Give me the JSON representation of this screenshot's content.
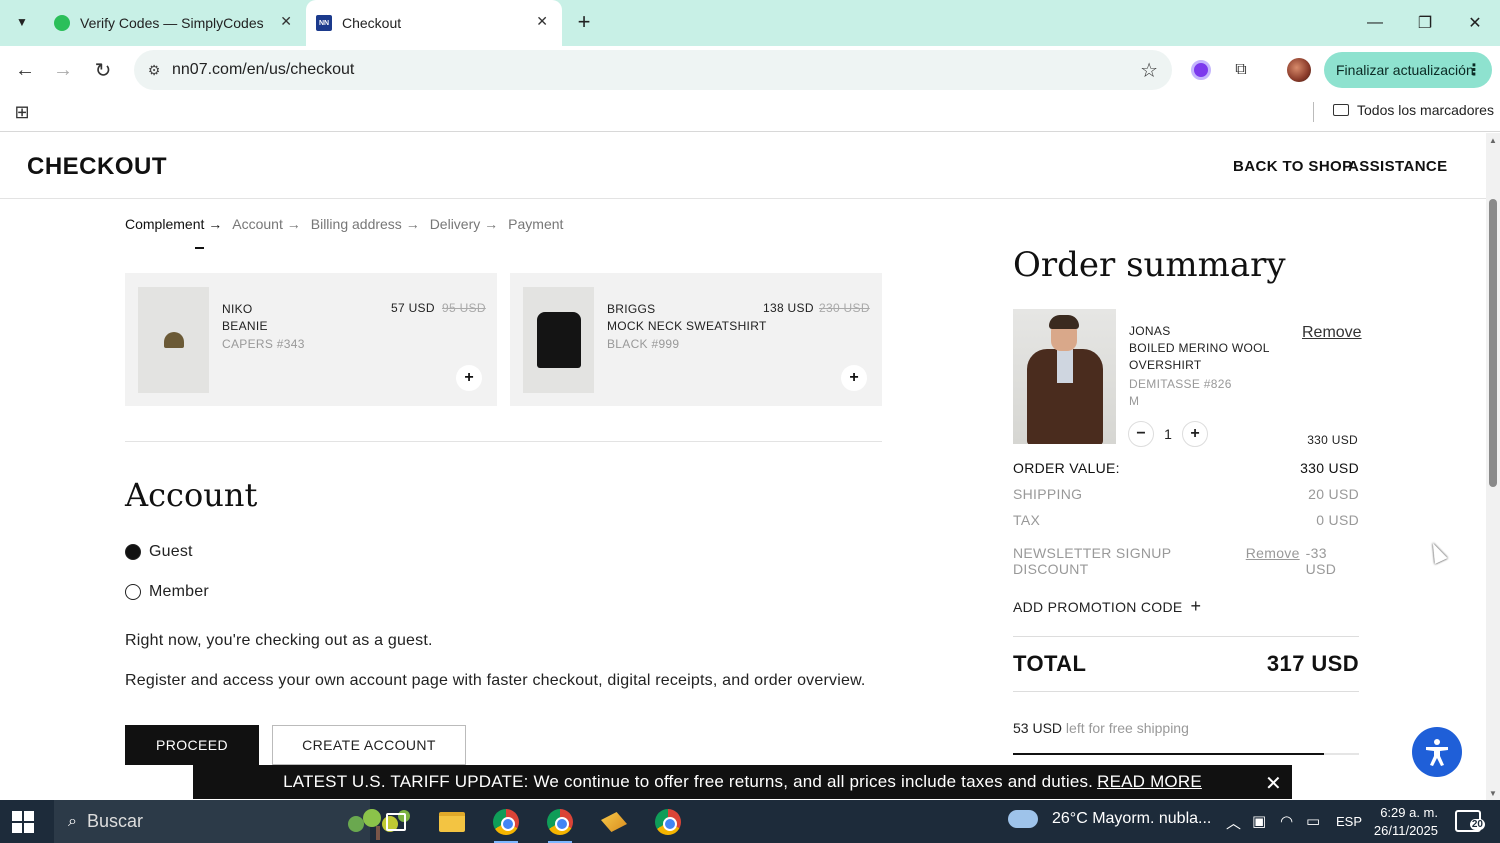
{
  "browser": {
    "tabs": [
      {
        "title": "Verify Codes — SimplyCodes",
        "active": false
      },
      {
        "title": "Checkout",
        "active": true
      }
    ],
    "url": "nn07.com/en/us/checkout",
    "update_button": "Finalizar actualización",
    "bookmarks_all": "Todos los marcadores"
  },
  "site": {
    "logo": "CHECKOUT",
    "nav": {
      "back_to_shop": "BACK TO SHOP",
      "assistance": "ASSISTANCE"
    }
  },
  "steps": [
    "Complement →",
    "Account →",
    "Billing address →",
    "Delivery →",
    "Payment"
  ],
  "recommendations": [
    {
      "brand": "NIKO",
      "name": "BEANIE",
      "color": "CAPERS #343",
      "price": "57 USD",
      "old_price": "95 USD"
    },
    {
      "brand": "BRIGGS",
      "name": "MOCK NECK SWEATSHIRT",
      "color": "BLACK #999",
      "price": "138 USD",
      "old_price": "230 USD"
    }
  ],
  "account": {
    "title": "Account",
    "options": [
      {
        "label": "Guest",
        "selected": true
      },
      {
        "label": "Member",
        "selected": false
      }
    ],
    "guest_text": "Right now, you're checking out as a guest.",
    "register_text": "Register and access your own account page with faster checkout, digital receipts, and order overview.",
    "proceed": "PROCEED",
    "create_account": "CREATE ACCOUNT"
  },
  "summary": {
    "title": "Order summary",
    "item": {
      "brand": "JONAS",
      "name_line1": "BOILED MERINO WOOL",
      "name_line2": "OVERSHIRT",
      "color": "DEMITASSE #826",
      "size": "M",
      "quantity": "1",
      "price": "330 USD",
      "remove": "Remove"
    },
    "order_value_label": "ORDER VALUE:",
    "order_value": "330 USD",
    "shipping_label": "SHIPPING",
    "shipping": "20 USD",
    "tax_label": "TAX",
    "tax": "0 USD",
    "discount_label": "NEWSLETTER SIGNUP DISCOUNT",
    "discount_remove": "Remove",
    "discount": "-33 USD",
    "promo_label": "ADD PROMOTION CODE",
    "total_label": "TOTAL",
    "total": "317 USD",
    "free_shipping_amount": "53 USD",
    "free_shipping_text": "left for free shipping",
    "free_shipping_progress": 0.9
  },
  "banner": {
    "text": "LATEST U.S. TARIFF UPDATE: We continue to offer free returns, and all prices include taxes and duties.",
    "link": "READ MORE"
  },
  "taskbar": {
    "search_placeholder": "Buscar",
    "weather": "26°C  Mayorm. nubla...",
    "language": "ESP",
    "time": "6:29 a. m.",
    "date": "26/11/2025",
    "notifications": "20"
  },
  "colors": {
    "tab_bar": "#c8f0e6",
    "update_button": "#8ee2cf",
    "accessibility": "#1f5fd8",
    "taskbar": "#1d2b3a"
  }
}
